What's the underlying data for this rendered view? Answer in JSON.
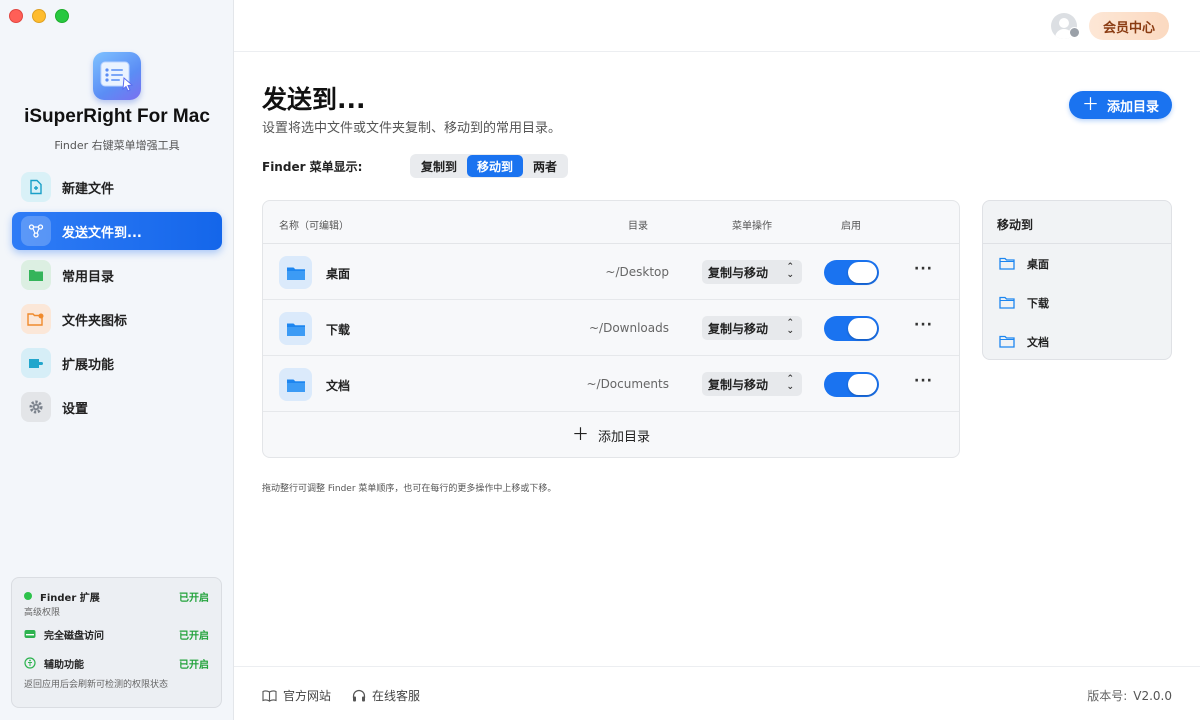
{
  "window": {
    "controls": [
      "close",
      "minimize",
      "zoom"
    ]
  },
  "app": {
    "name": "iSuperRight For Mac",
    "subtitle": "Finder 右键菜单增强工具"
  },
  "sidebar": {
    "items": [
      {
        "label": "新建文件",
        "icon": "new-file-icon"
      },
      {
        "label": "发送文件到...",
        "icon": "share-nodes-icon",
        "active": true
      },
      {
        "label": "常用目录",
        "icon": "folder-icon"
      },
      {
        "label": "文件夹图标",
        "icon": "folder-image-icon"
      },
      {
        "label": "扩展功能",
        "icon": "puzzle-icon"
      },
      {
        "label": "设置",
        "icon": "gear-icon"
      }
    ]
  },
  "permissions": {
    "finder_ext": {
      "label": "Finder 扩展",
      "status": "已开启"
    },
    "advanced_label": "高级权限",
    "disk": {
      "label": "完全磁盘访问",
      "status": "已开启"
    },
    "accessibility": {
      "label": "辅助功能",
      "status": "已开启"
    },
    "note": "返回应用后会刷新可检测的权限状态"
  },
  "header": {
    "vip_label": "会员中心"
  },
  "main": {
    "title": "发送到...",
    "description": "设置将选中文件或文件夹复制、移动到的常用目录。",
    "add_button": "添加目录",
    "menu_mode_label": "Finder 菜单显示:",
    "segments": [
      "复制到",
      "移动到",
      "两者"
    ],
    "selected_segment": "移动到",
    "table": {
      "headers": {
        "name": "名称（可编辑）",
        "dir": "目录",
        "action": "菜单操作",
        "enabled": "启用"
      },
      "rows": [
        {
          "name": "桌面",
          "path": "~/Desktop",
          "action": "复制与移动",
          "enabled": true
        },
        {
          "name": "下载",
          "path": "~/Downloads",
          "action": "复制与移动",
          "enabled": true
        },
        {
          "name": "文档",
          "path": "~/Documents",
          "action": "复制与移动",
          "enabled": true
        }
      ],
      "add_row_label": "添加目录"
    },
    "hint": "拖动整行可调整 Finder 菜单顺序，也可在每行的更多操作中上移或下移。"
  },
  "preview": {
    "title": "移动到",
    "items": [
      "桌面",
      "下载",
      "文档"
    ]
  },
  "footer": {
    "website": "官方网站",
    "support": "在线客服",
    "version_label": "版本号:",
    "version": "V2.0.0"
  },
  "colors": {
    "accent": "#1a73f0",
    "success": "#22a33b",
    "vip_text": "#8a3b12"
  }
}
